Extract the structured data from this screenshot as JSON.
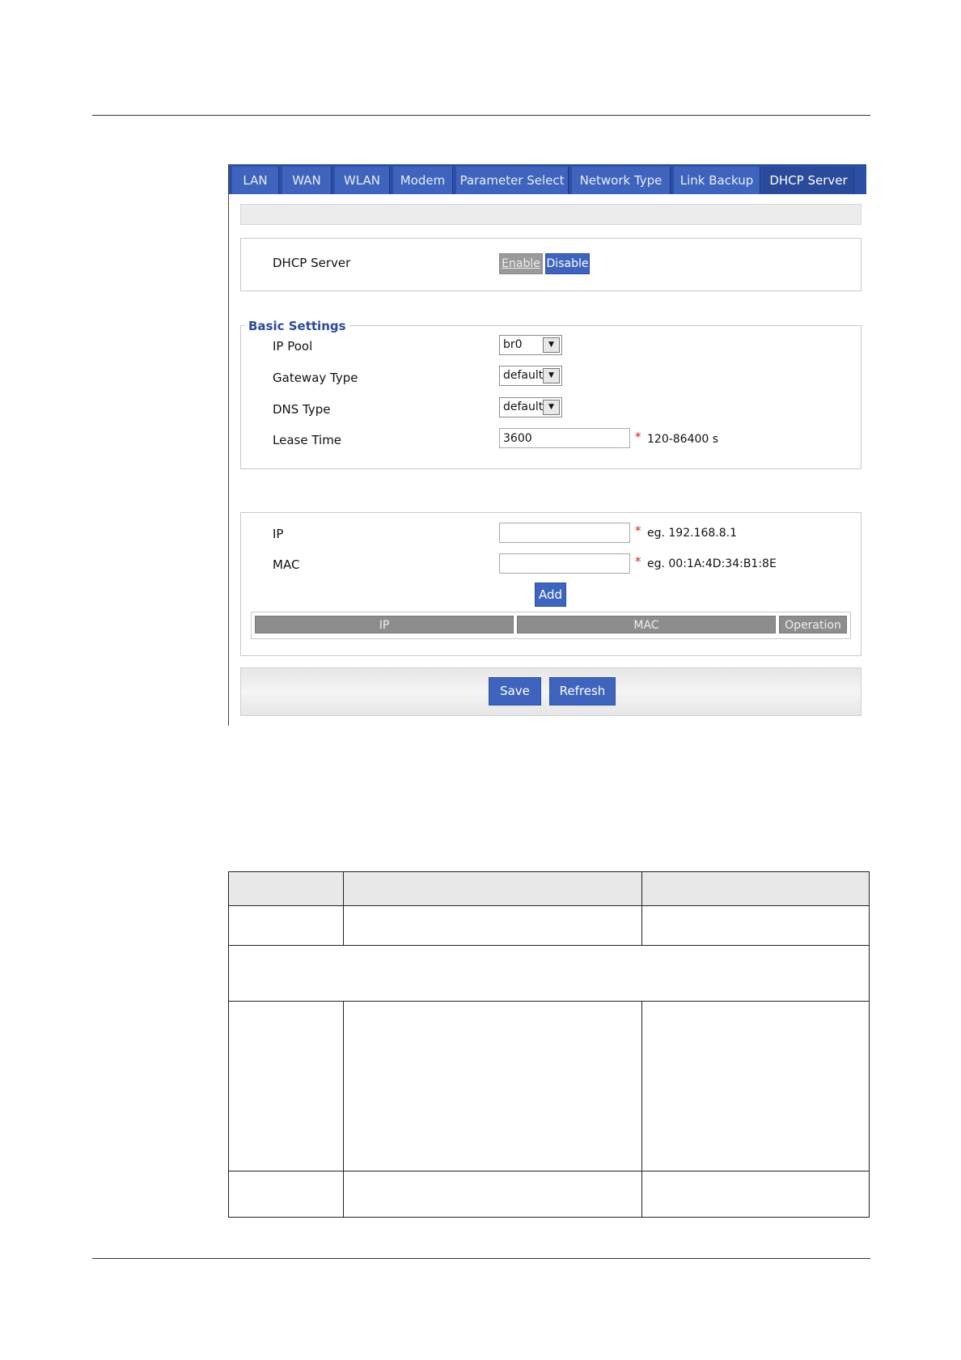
{
  "tabs": [
    {
      "label": "LAN"
    },
    {
      "label": "WAN"
    },
    {
      "label": "WLAN"
    },
    {
      "label": "Modem"
    },
    {
      "label": "Parameter Select"
    },
    {
      "label": "Network Type"
    },
    {
      "label": "Link Backup"
    },
    {
      "label": "DHCP Server"
    }
  ],
  "dhcp": {
    "label": "DHCP Server",
    "enable_label": "Enable",
    "disable_label": "Disable"
  },
  "basic": {
    "legend": "Basic Settings",
    "ip_pool_label": "IP Pool",
    "ip_pool_value": "br0",
    "gateway_label": "Gateway Type",
    "gateway_value": "default",
    "dns_label": "DNS Type",
    "dns_value": "default",
    "lease_label": "Lease Time",
    "lease_value": "3600",
    "lease_hint": "120-86400 s"
  },
  "binding": {
    "ip_label": "IP",
    "ip_hint": "eg. 192.168.8.1",
    "mac_label": "MAC",
    "mac_hint": "eg. 00:1A:4D:34:B1:8E",
    "add_label": "Add",
    "columns": [
      "IP",
      "MAC",
      "Operation"
    ]
  },
  "actions": {
    "save_label": "Save",
    "refresh_label": "Refresh"
  },
  "required_mark": "*",
  "colors": {
    "tab_bar": "#2c4fa5",
    "button_blue": "#3f64bd",
    "legend_text": "#2d4a9b",
    "required": "#e02020"
  },
  "icons": [
    "dropdown-arrow-icon"
  ]
}
